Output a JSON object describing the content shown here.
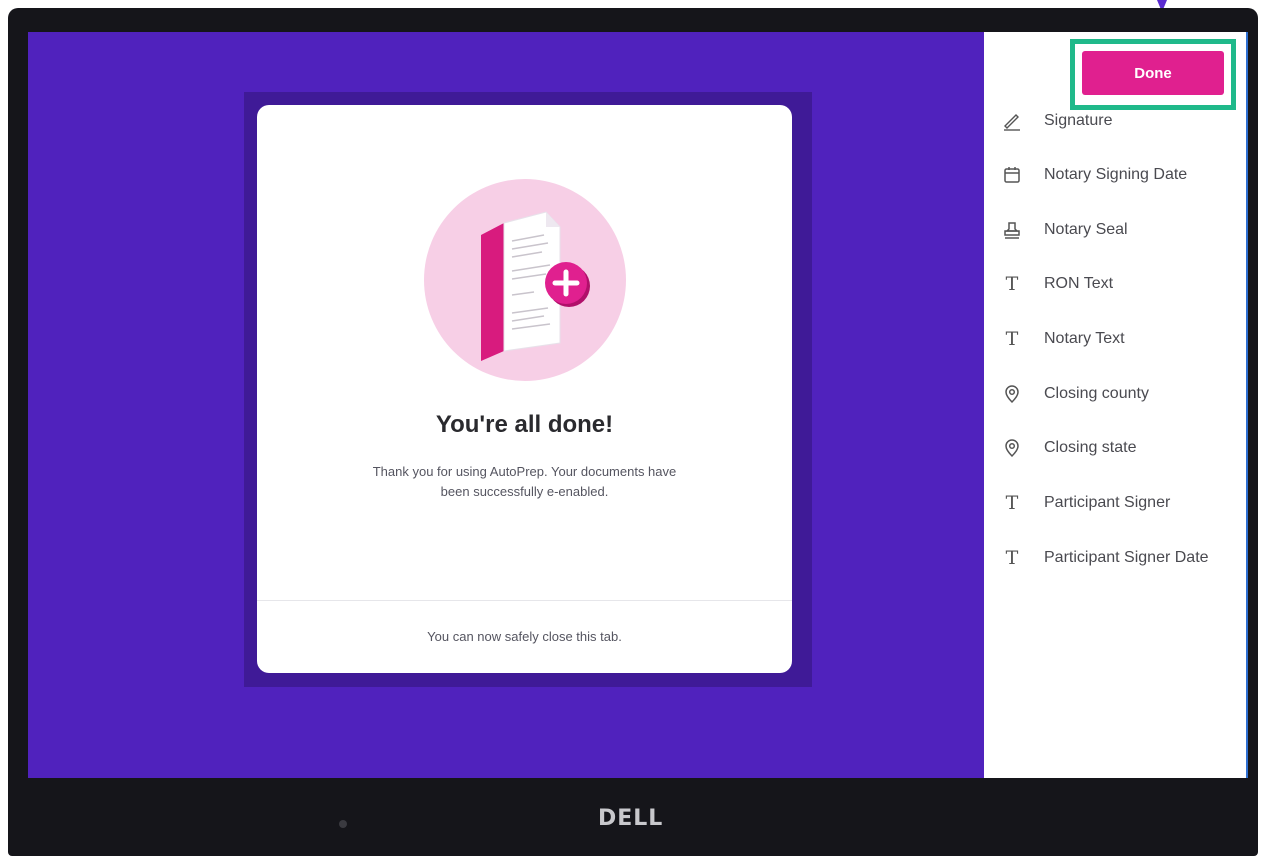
{
  "modal": {
    "title": "You're all done!",
    "message": "Thank you for using AutoPrep. Your documents have been successfully e-enabled.",
    "footer": "You can now safely close this tab."
  },
  "sidebar": {
    "done_label": "Done",
    "fields": [
      {
        "label": "Signature",
        "icon": "signature-pen-icon"
      },
      {
        "label": "Notary Signing Date",
        "icon": "calendar-icon"
      },
      {
        "label": "Notary Seal",
        "icon": "stamp-icon"
      },
      {
        "label": "RON Text",
        "icon": "text-icon"
      },
      {
        "label": "Notary Text",
        "icon": "text-icon"
      },
      {
        "label": "Closing county",
        "icon": "location-pin-icon"
      },
      {
        "label": "Closing state",
        "icon": "location-pin-icon"
      },
      {
        "label": "Participant Signer",
        "icon": "text-icon"
      },
      {
        "label": "Participant Signer Date",
        "icon": "text-icon"
      }
    ]
  },
  "monitor": {
    "brand": "DELL"
  },
  "colors": {
    "background": "#5022bd",
    "accent": "#e0208f",
    "highlight": "#1fb98a"
  }
}
